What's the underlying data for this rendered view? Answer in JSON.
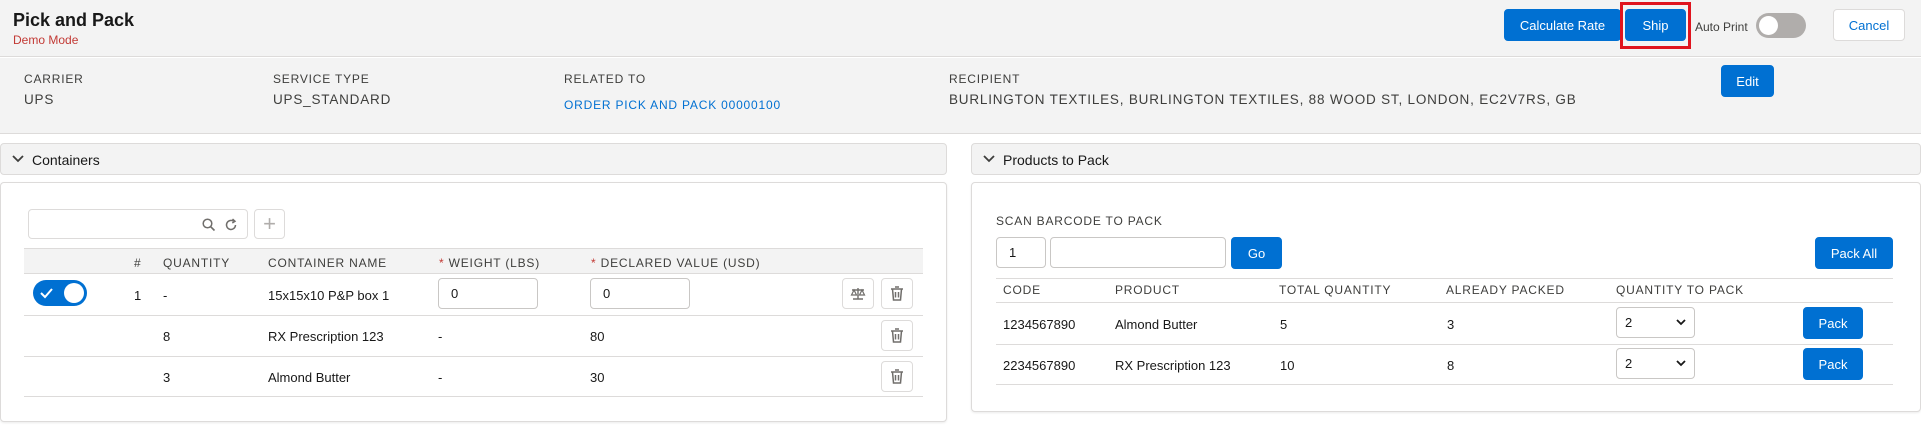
{
  "header": {
    "title": "Pick and Pack",
    "subtitle": "Demo Mode",
    "calculate_rate": "Calculate Rate",
    "ship": "Ship",
    "auto_print": "Auto Print",
    "cancel": "Cancel"
  },
  "info": {
    "carrier_label": "CARRIER",
    "carrier": "UPS",
    "service_label": "SERVICE TYPE",
    "service": "UPS_STANDARD",
    "related_label": "RELATED TO",
    "related": "ORDER PICK AND PACK 00000100",
    "recipient_label": "RECIPIENT",
    "recipient": "BURLINGTON TEXTILES, BURLINGTON TEXTILES, 88 WOOD ST, LONDON, EC2V7RS, GB",
    "edit": "Edit"
  },
  "containers": {
    "title": "Containers",
    "columns": [
      "#",
      "QUANTITY",
      "CONTAINER NAME",
      "WEIGHT (LBS)",
      "DECLARED VALUE (USD)"
    ],
    "rows": [
      {
        "num": "1",
        "quantity": "-",
        "name": "15x15x10 P&P box 1",
        "weight": "0",
        "value": "0"
      },
      {
        "num": "",
        "quantity": "8",
        "name": "RX Prescription 123",
        "weight": "-",
        "value": "80"
      },
      {
        "num": "",
        "quantity": "3",
        "name": "Almond Butter",
        "weight": "-",
        "value": "30"
      }
    ]
  },
  "products": {
    "title": "Products to Pack",
    "scan_label": "SCAN BARCODE TO PACK",
    "scan_qty": "1",
    "go": "Go",
    "pack_all": "Pack All",
    "columns": [
      "CODE",
      "PRODUCT",
      "TOTAL QUANTITY",
      "ALREADY PACKED",
      "QUANTITY TO PACK"
    ],
    "rows": [
      {
        "code": "1234567890",
        "product": "Almond Butter",
        "total": "5",
        "packed": "3",
        "to_pack": "2",
        "pack": "Pack"
      },
      {
        "code": "2234567890",
        "product": "RX Prescription 123",
        "total": "10",
        "packed": "8",
        "to_pack": "2",
        "pack": "Pack"
      }
    ]
  },
  "colors": {
    "brand": "#0070d2",
    "highlight": "#e0141e",
    "required": "#c23934"
  }
}
